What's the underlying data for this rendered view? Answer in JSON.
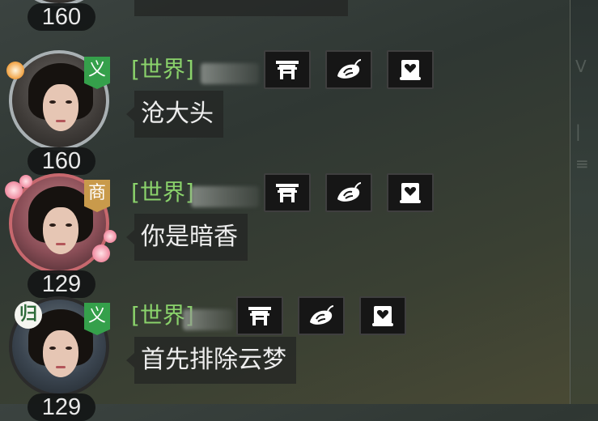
{
  "messages": [
    {
      "level": "160",
      "partial": true,
      "text": "",
      "channel": ""
    },
    {
      "level": "160",
      "rank_tag": "义",
      "channel": "[世界]",
      "text": "沧大头",
      "ring_style": "silver",
      "tag_color": "#35a04b",
      "actions": [
        "house-icon",
        "sweet-potato-icon",
        "heart-scroll-icon"
      ]
    },
    {
      "level": "129",
      "rank_tag": "商",
      "channel": "[世界]",
      "text": "你是暗香",
      "ring_style": "pink",
      "tag_color": "#c99a4b",
      "actions": [
        "house-icon",
        "sweet-potato-icon",
        "heart-scroll-icon"
      ]
    },
    {
      "level": "129",
      "rank_tag": "义",
      "emblem": "归",
      "channel": "[世界]",
      "text": "首先排除云梦",
      "ring_style": "dark",
      "tag_color": "#35a04b",
      "actions": [
        "house-icon",
        "sweet-potato-icon",
        "heart-scroll-icon"
      ]
    }
  ],
  "colors": {
    "channel_text": "#8ad26b",
    "message_text": "#ededed",
    "level_text": "#e9e9e9",
    "background": "#333a36"
  }
}
